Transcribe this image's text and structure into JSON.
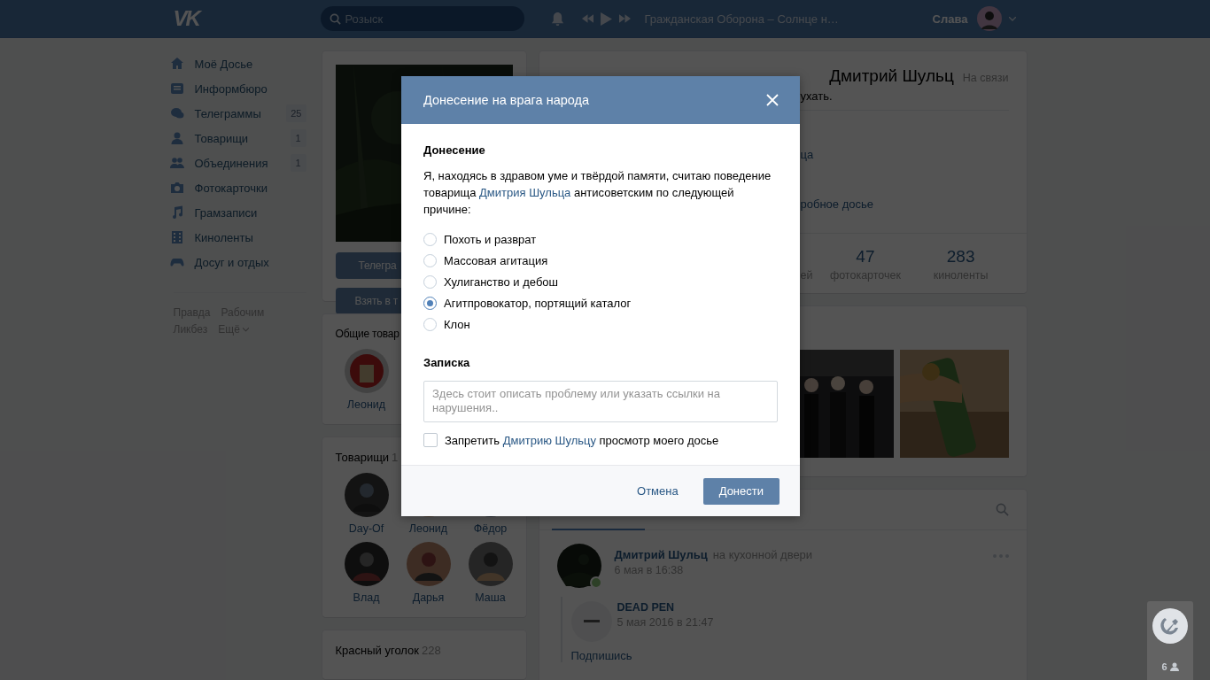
{
  "header": {
    "logo": "VK",
    "search": {
      "placeholder": "Розыск"
    },
    "now_playing": "Гражданская Оборона – Солнце н…",
    "user": "Слава"
  },
  "sidebar": {
    "items": [
      {
        "label": "Моё Досье"
      },
      {
        "label": "Информбюро"
      },
      {
        "label": "Телеграммы",
        "count": "25"
      },
      {
        "label": "Товарищи",
        "count": "1"
      },
      {
        "label": "Объединения",
        "count": "1"
      },
      {
        "label": "Фотокарточки"
      },
      {
        "label": "Грамзаписи"
      },
      {
        "label": "Киноленты"
      },
      {
        "label": "Досуг и отдых"
      }
    ],
    "footer_links": [
      {
        "label": "Правда",
        "kind": "link"
      },
      {
        "label": "Рабочим",
        "kind": "link"
      },
      {
        "label": "Ликбез",
        "kind": "link"
      },
      {
        "label": "Ещё",
        "kind": "more"
      }
    ]
  },
  "profile_column": {
    "buttons": [
      "Телегра",
      "Взять в т"
    ],
    "common_friends": {
      "title": "Общие товар",
      "friends": [
        "Леонид"
      ]
    },
    "friends": {
      "title": "Товарищи",
      "count": "1",
      "items": [
        "Day-Of",
        "Леонид",
        "Фёдор",
        "Влад",
        "Дарья",
        "Маша"
      ]
    },
    "red_corner": {
      "title": "Красный уголок",
      "count": "228"
    }
  },
  "profile": {
    "name": "Дмитрий Шульц",
    "online": "На связи",
    "status": "ухать.",
    "info_links": [
      "ца",
      "робное досье"
    ],
    "stats": [
      {
        "label": "ей"
      },
      {
        "value": "47",
        "label": "фотокарточек"
      },
      {
        "value": "283",
        "label": "киноленты"
      }
    ]
  },
  "wall": {
    "post": {
      "author": "Дмитрий Шульц",
      "place": "на кухонной двери",
      "time": "6 мая в 16:38",
      "online": true,
      "repost": {
        "author": "DEAD PEN",
        "time": "5 мая 2016 в 21:47",
        "text": "Подпишись"
      }
    }
  },
  "widget": {
    "count": "6"
  },
  "modal": {
    "title": "Донесение на врага народа",
    "section_title": "Донесение",
    "intro": "Я, находясь в здравом уме и твёрдой памяти, считаю поведение товарища",
    "intro_link": "Дмитрия Шульца",
    "intro_end": "антисоветским по следующей причине:",
    "reasons": [
      {
        "label": "Похоть и разврат",
        "selected": false
      },
      {
        "label": "Массовая агитация",
        "selected": false
      },
      {
        "label": "Хулиганство и дебош",
        "selected": false
      },
      {
        "label": "Агитпровокатор, портящий каталог",
        "selected": true
      },
      {
        "label": "Клон",
        "selected": false
      }
    ],
    "note": {
      "title": "Записка",
      "placeholder": "Здесь стоит описать проблему или указать ссылки на нарушения.."
    },
    "ban": {
      "checked": false,
      "text": "Запретить",
      "link": "Дмитрию Шульцу",
      "text_end": "просмотр моего досье"
    },
    "cancel": "Отмена",
    "submit": "Донести"
  }
}
